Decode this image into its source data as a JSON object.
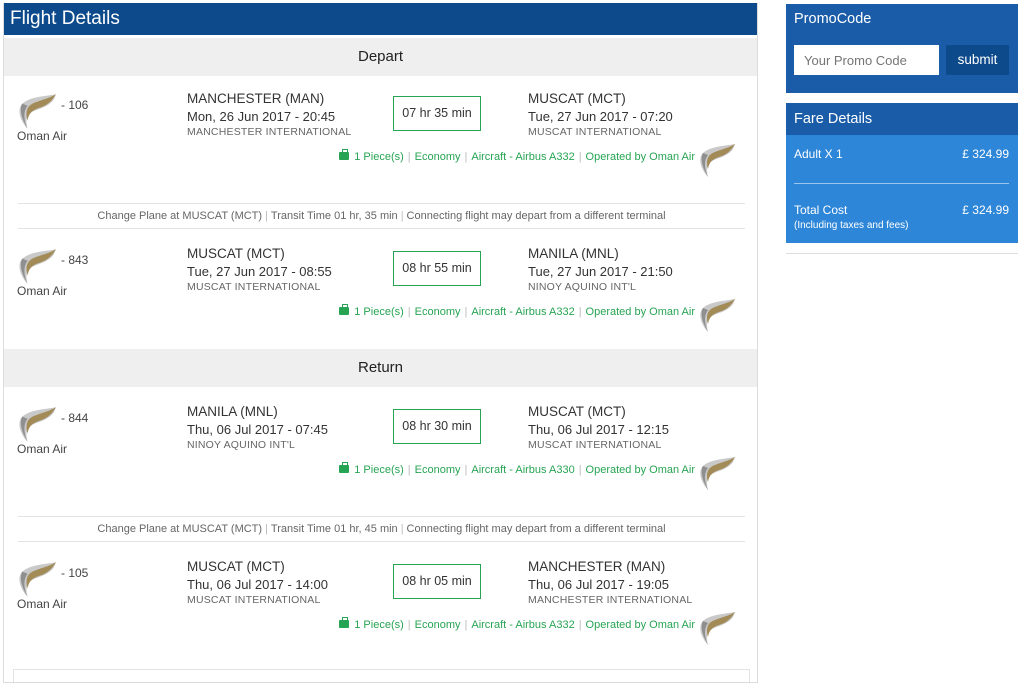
{
  "header": {
    "title": "Flight Details"
  },
  "sections": {
    "depart": "Depart",
    "return": "Return"
  },
  "segments": [
    {
      "flight_no": "- 106",
      "airline": "Oman Air",
      "from_city": "MANCHESTER (MAN)",
      "from_dt": "Mon, 26 Jun 2017 - 20:45",
      "from_airport": "MANCHESTER INTERNATIONAL",
      "duration": "07 hr 35 min",
      "to_city": "MUSCAT (MCT)",
      "to_dt": "Tue, 27 Jun 2017 - 07:20",
      "to_airport": "MUSCAT INTERNATIONAL",
      "baggage": "1 Piece(s)",
      "cabin": "Economy",
      "aircraft": "Aircraft - Airbus A332",
      "operated": "Operated by Oman Air"
    },
    {
      "flight_no": "- 843",
      "airline": "Oman Air",
      "from_city": "MUSCAT (MCT)",
      "from_dt": "Tue, 27 Jun 2017 - 08:55",
      "from_airport": "MUSCAT INTERNATIONAL",
      "duration": "08 hr 55 min",
      "to_city": "MANILA (MNL)",
      "to_dt": "Tue, 27 Jun 2017 - 21:50",
      "to_airport": "NINOY AQUINO INT'L",
      "baggage": "1 Piece(s)",
      "cabin": "Economy",
      "aircraft": "Aircraft - Airbus A332",
      "operated": "Operated by Oman Air"
    },
    {
      "flight_no": "- 844",
      "airline": "Oman Air",
      "from_city": "MANILA (MNL)",
      "from_dt": "Thu, 06 Jul 2017 - 07:45",
      "from_airport": "NINOY AQUINO INT'L",
      "duration": "08 hr 30 min",
      "to_city": "MUSCAT (MCT)",
      "to_dt": "Thu, 06 Jul 2017 - 12:15",
      "to_airport": "MUSCAT INTERNATIONAL",
      "baggage": "1 Piece(s)",
      "cabin": "Economy",
      "aircraft": "Aircraft - Airbus A330",
      "operated": "Operated by Oman Air"
    },
    {
      "flight_no": "- 105",
      "airline": "Oman Air",
      "from_city": "MUSCAT (MCT)",
      "from_dt": "Thu, 06 Jul 2017 - 14:00",
      "from_airport": "MUSCAT INTERNATIONAL",
      "duration": "08 hr 05 min",
      "to_city": "MANCHESTER (MAN)",
      "to_dt": "Thu, 06 Jul 2017 - 19:05",
      "to_airport": "MANCHESTER INTERNATIONAL",
      "baggage": "1 Piece(s)",
      "cabin": "Economy",
      "aircraft": "Aircraft - Airbus A332",
      "operated": "Operated by Oman Air"
    }
  ],
  "transits": [
    {
      "change": "Change Plane at MUSCAT (MCT)",
      "time": "Transit Time 01 hr, 35 min",
      "note": "Connecting flight may depart from a different terminal"
    },
    {
      "change": "Change Plane at MUSCAT (MCT)",
      "time": "Transit Time 01 hr, 45 min",
      "note": "Connecting flight may depart from a different terminal"
    }
  ],
  "separator": "|",
  "promo": {
    "title": "PromoCode",
    "placeholder": "Your Promo Code",
    "submit": "submit"
  },
  "fare": {
    "title": "Fare Details",
    "adult_label": "Adult X 1",
    "adult_value": "£ 324.99",
    "total_label": "Total Cost",
    "total_note": "(Including taxes and fees)",
    "total_value": "£ 324.99"
  },
  "icons": {
    "logo": "oman-air-wing-logo",
    "baggage": "briefcase-icon"
  },
  "colors": {
    "header": "#0d4a8b",
    "promo_bg": "#1a5ca8",
    "fare_bg": "#2e86d8",
    "green": "#27a453"
  }
}
